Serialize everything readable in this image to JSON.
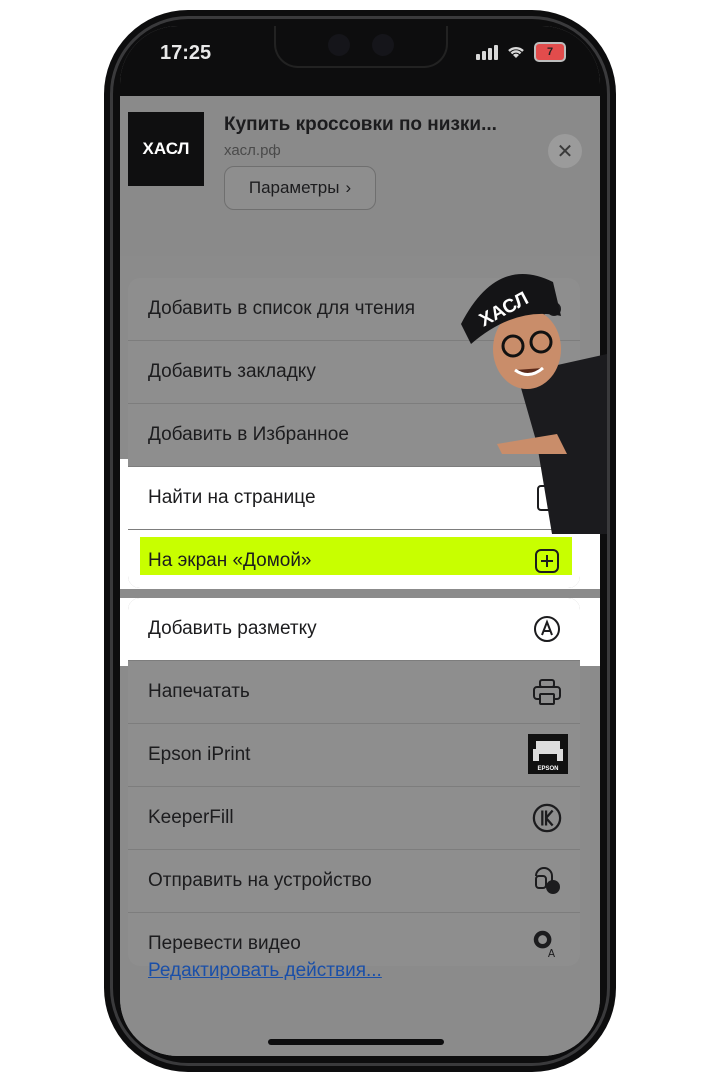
{
  "status_bar": {
    "time": "17:25",
    "battery": "7"
  },
  "share_sheet": {
    "site_logo_text": "ХАСЛ",
    "site_title": "Купить кроссовки по низки...",
    "site_url": "хасл.рф",
    "params_label": "Параметры",
    "params_chevron": "›",
    "close_glyph": "✕"
  },
  "actions_group1": [
    {
      "label": "Добавить в список для чтения",
      "icon": "glasses-icon"
    },
    {
      "label": "Добавить закладку",
      "icon": "book-icon"
    },
    {
      "label": "Добавить в Избранное",
      "icon": "star-icon"
    },
    {
      "label": "Найти на странице",
      "icon": "doc-search-icon"
    },
    {
      "label": "На экран «Домой»",
      "icon": "add-square-icon"
    }
  ],
  "actions_group2": [
    {
      "label": "Добавить разметку",
      "icon": "markup-icon"
    },
    {
      "label": "Напечатать",
      "icon": "printer-icon"
    },
    {
      "label": "Epson iPrint",
      "icon": "epson-icon"
    },
    {
      "label": "KeeperFill",
      "icon": "keeper-icon"
    },
    {
      "label": "Отправить на устройство",
      "icon": "send-device-icon"
    },
    {
      "label": "Перевести видео",
      "icon": "translate-video-icon"
    }
  ],
  "epson_caption": "EPSON",
  "mascot_cap_text": "ХАСЛ",
  "edit_actions_link": "Редактировать действия...",
  "colors": {
    "highlight": "#c8ff00",
    "link": "#1a4fa8",
    "overlay": "#8b8b8b"
  }
}
